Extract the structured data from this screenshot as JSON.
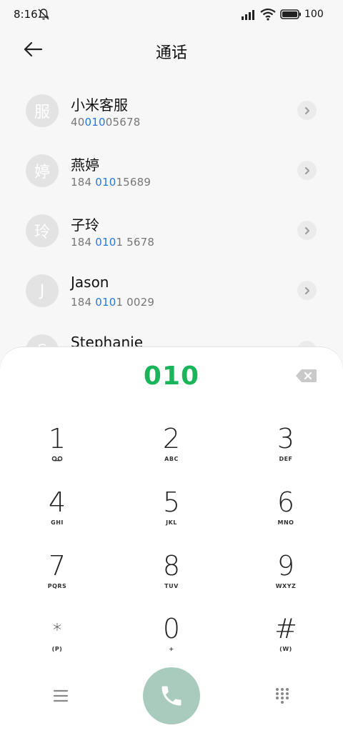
{
  "status_bar": {
    "time": "8:16",
    "battery": "100",
    "icons": [
      "bell-off-icon",
      "signal-icon",
      "wifi-icon",
      "battery-icon"
    ]
  },
  "header": {
    "title": "通话",
    "back_icon": "arrow-left-icon"
  },
  "contacts": [
    {
      "avatar": "服",
      "name": "小米客服",
      "number_pre": "40",
      "number_hl": "010",
      "number_post": "05678"
    },
    {
      "avatar": "婷",
      "name": "燕婷",
      "number_pre": "184 ",
      "number_hl": "010",
      "number_post": "15689"
    },
    {
      "avatar": "玲",
      "name": "子玲",
      "number_pre": "184 ",
      "number_hl": "010",
      "number_post": "1 5678"
    },
    {
      "avatar": "J",
      "name": "Jason",
      "number_pre": "184 ",
      "number_hl": "010",
      "number_post": "1 0029"
    },
    {
      "avatar": "S",
      "name": "Stephanie",
      "number_pre": "",
      "number_hl": "",
      "number_post": ""
    }
  ],
  "dialpad": {
    "input": "010",
    "keys": [
      {
        "digit": "1",
        "letters": ""
      },
      {
        "digit": "2",
        "letters": "ABC"
      },
      {
        "digit": "3",
        "letters": "DEF"
      },
      {
        "digit": "4",
        "letters": "GHI"
      },
      {
        "digit": "5",
        "letters": "JKL"
      },
      {
        "digit": "6",
        "letters": "MNO"
      },
      {
        "digit": "7",
        "letters": "PQRS"
      },
      {
        "digit": "8",
        "letters": "TUV"
      },
      {
        "digit": "9",
        "letters": "WXYZ"
      },
      {
        "digit": "*",
        "letters": "(P)"
      },
      {
        "digit": "0",
        "letters": "+"
      },
      {
        "digit": "#",
        "letters": "(W)"
      }
    ]
  },
  "colors": {
    "accent_green": "#1ab55a",
    "highlight_blue": "#2878d8",
    "call_button": "#a9cbbd"
  }
}
